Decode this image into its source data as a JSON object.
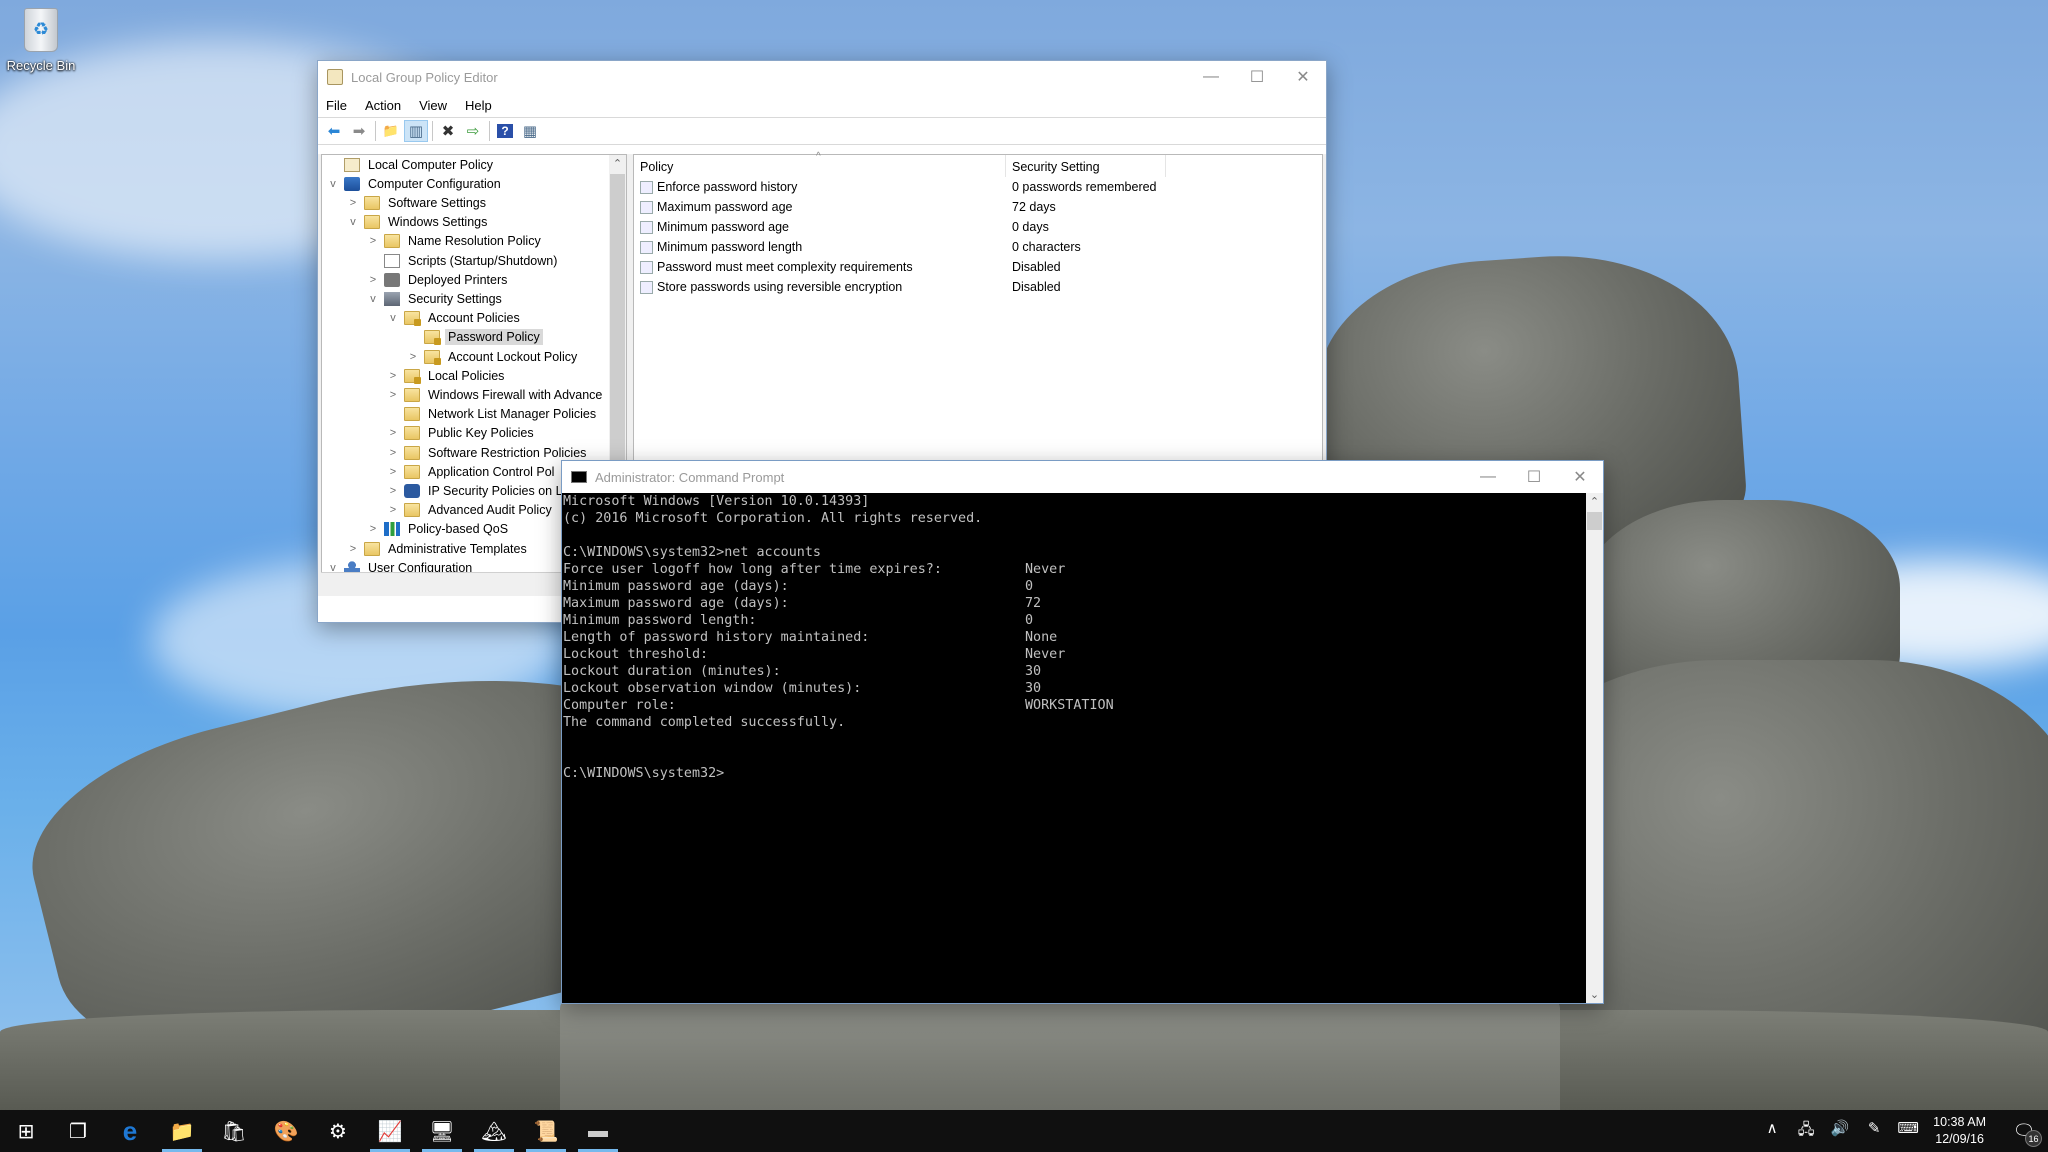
{
  "desktop": {
    "icons": [
      {
        "label": "Recycle Bin",
        "icon": "recycle-bin-icon"
      }
    ]
  },
  "gpe": {
    "title": "Local Group Policy Editor",
    "menu": [
      "File",
      "Action",
      "View",
      "Help"
    ],
    "toolbar": [
      {
        "name": "back-arrow-icon",
        "glyph": "⬅"
      },
      {
        "name": "forward-arrow-icon",
        "glyph": "➡"
      },
      {
        "name": "up-folder-icon",
        "glyph": "📁"
      },
      {
        "name": "show-hide-tree-icon",
        "glyph": "▥"
      },
      {
        "name": "delete-icon",
        "glyph": "✖"
      },
      {
        "name": "export-list-icon",
        "glyph": "⇨"
      },
      {
        "name": "help-icon",
        "glyph": "?"
      },
      {
        "name": "show-hide-action-pane-icon",
        "glyph": "▦"
      }
    ],
    "tree": [
      {
        "label": "Local Computer Policy",
        "level": 0,
        "exp": "",
        "icon": "policy"
      },
      {
        "label": "Computer Configuration",
        "level": 0,
        "exp": "v",
        "icon": "computer"
      },
      {
        "label": "Software Settings",
        "level": 1,
        "exp": ">",
        "icon": "folder"
      },
      {
        "label": "Windows Settings",
        "level": 1,
        "exp": "v",
        "icon": "folder"
      },
      {
        "label": "Name Resolution Policy",
        "level": 2,
        "exp": ">",
        "icon": "folder"
      },
      {
        "label": "Scripts (Startup/Shutdown)",
        "level": 2,
        "exp": "",
        "icon": "script"
      },
      {
        "label": "Deployed Printers",
        "level": 2,
        "exp": ">",
        "icon": "printer"
      },
      {
        "label": "Security Settings",
        "level": 2,
        "exp": "v",
        "icon": "sec"
      },
      {
        "label": "Account Policies",
        "level": 3,
        "exp": "v",
        "icon": "folder lock"
      },
      {
        "label": "Password Policy",
        "level": 4,
        "exp": "",
        "icon": "folder lock",
        "selected": true
      },
      {
        "label": "Account Lockout Policy",
        "level": 4,
        "exp": ">",
        "icon": "folder lock"
      },
      {
        "label": "Local Policies",
        "level": 3,
        "exp": ">",
        "icon": "folder lock"
      },
      {
        "label": "Windows Firewall with Advance",
        "level": 3,
        "exp": ">",
        "icon": "folder"
      },
      {
        "label": "Network List Manager Policies",
        "level": 3,
        "exp": "",
        "icon": "folder"
      },
      {
        "label": "Public Key Policies",
        "level": 3,
        "exp": ">",
        "icon": "folder"
      },
      {
        "label": "Software Restriction Policies",
        "level": 3,
        "exp": ">",
        "icon": "folder"
      },
      {
        "label": "Application Control Pol",
        "level": 3,
        "exp": ">",
        "icon": "folder"
      },
      {
        "label": "IP Security Policies on L",
        "level": 3,
        "exp": ">",
        "icon": "ipsec"
      },
      {
        "label": "Advanced Audit Policy",
        "level": 3,
        "exp": ">",
        "icon": "folder"
      },
      {
        "label": "Policy-based QoS",
        "level": 2,
        "exp": ">",
        "icon": "qos"
      },
      {
        "label": "Administrative Templates",
        "level": 1,
        "exp": ">",
        "icon": "folder"
      },
      {
        "label": "User Configuration",
        "level": 0,
        "exp": "v",
        "icon": "user"
      }
    ],
    "list": {
      "columns": [
        "Policy",
        "Security Setting"
      ],
      "rows": [
        {
          "policy": "Enforce password history",
          "setting": "0 passwords remembered"
        },
        {
          "policy": "Maximum password age",
          "setting": "72 days"
        },
        {
          "policy": "Minimum password age",
          "setting": "0 days"
        },
        {
          "policy": "Minimum password length",
          "setting": "0 characters"
        },
        {
          "policy": "Password must meet complexity requirements",
          "setting": "Disabled"
        },
        {
          "policy": "Store passwords using reversible encryption",
          "setting": "Disabled"
        }
      ]
    }
  },
  "cmd": {
    "title": "Administrator: Command Prompt",
    "lines": [
      {
        "text": "Microsoft Windows [Version 10.0.14393]",
        "value": ""
      },
      {
        "text": "(c) 2016 Microsoft Corporation. All rights reserved.",
        "value": ""
      },
      {
        "text": "",
        "value": ""
      },
      {
        "text": "C:\\WINDOWS\\system32>net accounts",
        "value": ""
      },
      {
        "text": "Force user logoff how long after time expires?:",
        "value": "Never"
      },
      {
        "text": "Minimum password age (days):",
        "value": "0"
      },
      {
        "text": "Maximum password age (days):",
        "value": "72"
      },
      {
        "text": "Minimum password length:",
        "value": "0"
      },
      {
        "text": "Length of password history maintained:",
        "value": "None"
      },
      {
        "text": "Lockout threshold:",
        "value": "Never"
      },
      {
        "text": "Lockout duration (minutes):",
        "value": "30"
      },
      {
        "text": "Lockout observation window (minutes):",
        "value": "30"
      },
      {
        "text": "Computer role:",
        "value": "WORKSTATION"
      },
      {
        "text": "The command completed successfully.",
        "value": ""
      },
      {
        "text": "",
        "value": ""
      },
      {
        "text": "",
        "value": ""
      },
      {
        "text": "C:\\WINDOWS\\system32>",
        "value": ""
      }
    ]
  },
  "window_controls": {
    "minimize": "—",
    "maximize": "☐",
    "close": "✕"
  },
  "taskbar": {
    "buttons": [
      {
        "name": "start-button",
        "icon": "windows-logo-icon",
        "glyph": "⊞",
        "running": false
      },
      {
        "name": "task-view-button",
        "icon": "task-view-icon",
        "glyph": "❐",
        "running": false
      },
      {
        "name": "edge-button",
        "icon": "edge-icon",
        "glyph": "e",
        "running": false
      },
      {
        "name": "file-explorer-button",
        "icon": "folder-icon",
        "glyph": "📁",
        "running": true
      },
      {
        "name": "store-button",
        "icon": "store-icon",
        "glyph": "🛍",
        "running": false
      },
      {
        "name": "paint-button",
        "icon": "paint-palette-icon",
        "glyph": "🎨",
        "running": false
      },
      {
        "name": "settings-button",
        "icon": "gear-icon",
        "glyph": "⚙",
        "running": false
      },
      {
        "name": "performance-monitor-button",
        "icon": "performance-monitor-icon",
        "glyph": "📈",
        "running": true
      },
      {
        "name": "control-panel-button",
        "icon": "control-panel-icon",
        "glyph": "🖥",
        "running": true
      },
      {
        "name": "photos-button",
        "icon": "photos-icon",
        "glyph": "🏔",
        "running": true
      },
      {
        "name": "group-policy-editor-button",
        "icon": "policy-scroll-icon",
        "glyph": "📜",
        "running": true
      },
      {
        "name": "command-prompt-button",
        "icon": "command-prompt-icon",
        "glyph": "▬",
        "running": true
      }
    ],
    "tray": [
      {
        "name": "show-hidden-icons-button",
        "icon": "chevron-up-icon",
        "glyph": "∧"
      },
      {
        "name": "network-button",
        "icon": "network-icon",
        "glyph": "🖧"
      },
      {
        "name": "volume-button",
        "icon": "speaker-icon",
        "glyph": "🔊"
      },
      {
        "name": "pen-workspace-button",
        "icon": "pen-icon",
        "glyph": "✎"
      },
      {
        "name": "touch-keyboard-button",
        "icon": "keyboard-icon",
        "glyph": "⌨"
      }
    ],
    "clock": {
      "time": "10:38 AM",
      "date": "12/09/16"
    },
    "notifications": {
      "count": "16"
    }
  }
}
